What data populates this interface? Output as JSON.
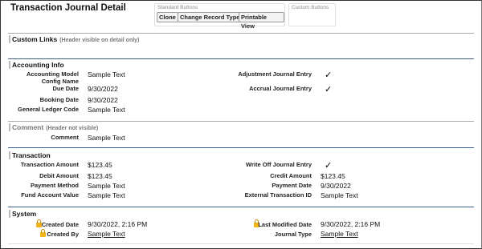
{
  "page": {
    "title": "Transaction Journal Detail",
    "standard_buttons_header": "Standard Buttons",
    "custom_buttons_header": "Custom Buttons",
    "buttons": [
      "Clone",
      "Change Record Type",
      "Printable View"
    ]
  },
  "custom_links": {
    "title": "Custom Links",
    "subtitle": "(Header visible on detail only)"
  },
  "accounting": {
    "title": "Accounting Info",
    "left": [
      {
        "label": "Accounting Model Config Name",
        "value": "Sample Text"
      },
      {
        "label": "Due Date",
        "value": "9/30/2022"
      },
      {
        "label": "Booking Date",
        "value": "9/30/2022"
      },
      {
        "label": "General Ledger Code",
        "value": "Sample Text"
      }
    ],
    "right": [
      {
        "label": "Adjustment Journal Entry",
        "value": "✓"
      },
      {
        "label": "Accrual Journal Entry",
        "value": "✓"
      }
    ]
  },
  "comment": {
    "title": "Comment",
    "subtitle": "(Header not visible)",
    "label": "Comment",
    "value": "Sample Text"
  },
  "transaction": {
    "title": "Transaction",
    "left": [
      {
        "label": "Transaction Amount",
        "value": "$123.45"
      },
      {
        "label": "Debit Amount",
        "value": "$123.45"
      },
      {
        "label": "Payment Method",
        "value": "Sample Text"
      },
      {
        "label": "Fund Account Value",
        "value": "Sample Text"
      }
    ],
    "right": [
      {
        "label": "Write Off Journal Entry",
        "value": "✓"
      },
      {
        "label": "Credit Amount",
        "value": "$123.45"
      },
      {
        "label": "Payment Date",
        "value": "9/30/2022"
      },
      {
        "label": "External Transaction ID",
        "value": "Sample Text"
      }
    ]
  },
  "system": {
    "title": "System",
    "created_date": {
      "label": "Created Date",
      "value": "9/30/2022, 2:16 PM"
    },
    "created_by": {
      "label": "Created By",
      "value": "Sample Text"
    },
    "last_modified_date": {
      "label": "Last Modified Date",
      "value": "9/30/2022, 2:16 PM"
    },
    "journal_type": {
      "label": "Journal Type",
      "value": "Sample Text"
    }
  },
  "colors": {
    "section_rule": "#3a5f8c",
    "lock": "#f1b419"
  }
}
